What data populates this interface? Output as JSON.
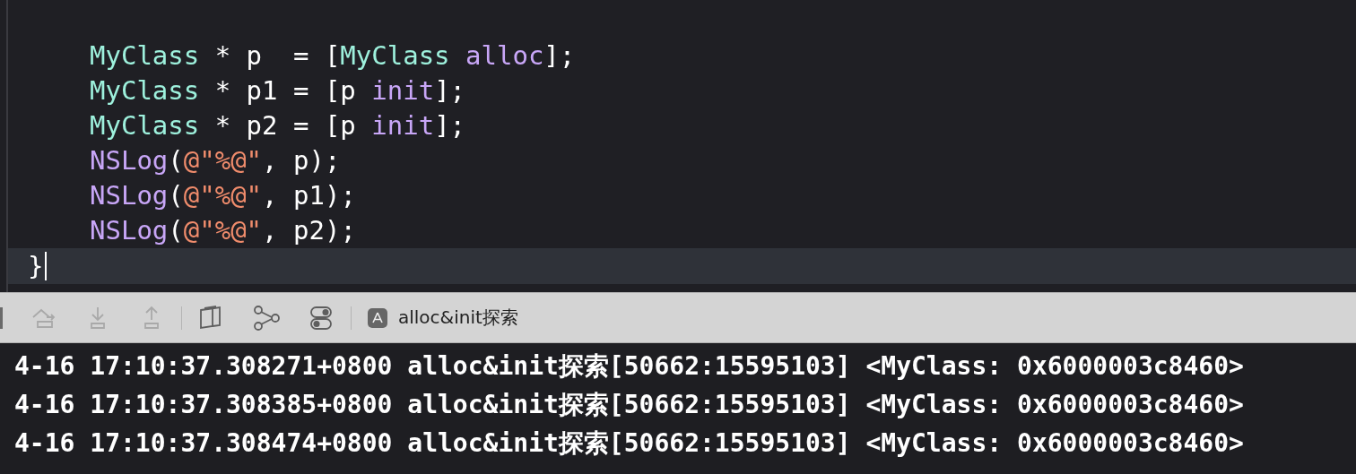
{
  "editor": {
    "lines": [
      {
        "current": false,
        "tokens": [
          {
            "kind": "type",
            "text": "MyClass"
          },
          {
            "kind": "plain",
            "text": " * p  = ["
          },
          {
            "kind": "type",
            "text": "MyClass "
          },
          {
            "kind": "method",
            "text": "alloc"
          },
          {
            "kind": "plain",
            "text": "];"
          }
        ]
      },
      {
        "current": false,
        "tokens": [
          {
            "kind": "type",
            "text": "MyClass"
          },
          {
            "kind": "plain",
            "text": " * p1 = [p "
          },
          {
            "kind": "method",
            "text": "init"
          },
          {
            "kind": "plain",
            "text": "];"
          }
        ]
      },
      {
        "current": false,
        "tokens": [
          {
            "kind": "type",
            "text": "MyClass"
          },
          {
            "kind": "plain",
            "text": " * p2 = [p "
          },
          {
            "kind": "method",
            "text": "init"
          },
          {
            "kind": "plain",
            "text": "];"
          }
        ]
      },
      {
        "current": false,
        "tokens": [
          {
            "kind": "method",
            "text": "NSLog"
          },
          {
            "kind": "plain",
            "text": "("
          },
          {
            "kind": "string",
            "text": "@\"%@\""
          },
          {
            "kind": "plain",
            "text": ", p);"
          }
        ]
      },
      {
        "current": false,
        "tokens": [
          {
            "kind": "method",
            "text": "NSLog"
          },
          {
            "kind": "plain",
            "text": "("
          },
          {
            "kind": "string",
            "text": "@\"%@\""
          },
          {
            "kind": "plain",
            "text": ", p1);"
          }
        ]
      },
      {
        "current": false,
        "tokens": [
          {
            "kind": "method",
            "text": "NSLog"
          },
          {
            "kind": "plain",
            "text": "("
          },
          {
            "kind": "string",
            "text": "@\"%@\""
          },
          {
            "kind": "plain",
            "text": ", p2);"
          }
        ]
      },
      {
        "current": true,
        "outdent": true,
        "tokens": [
          {
            "kind": "plain",
            "text": "}"
          }
        ]
      }
    ]
  },
  "toolbar": {
    "target": "alloc&init探索"
  },
  "console": {
    "lines": [
      "4-16 17:10:37.308271+0800 alloc&init探索[50662:15595103] <MyClass: 0x6000003c8460>",
      "4-16 17:10:37.308385+0800 alloc&init探索[50662:15595103] <MyClass: 0x6000003c8460>",
      "4-16 17:10:37.308474+0800 alloc&init探索[50662:15595103] <MyClass: 0x6000003c8460>"
    ]
  }
}
